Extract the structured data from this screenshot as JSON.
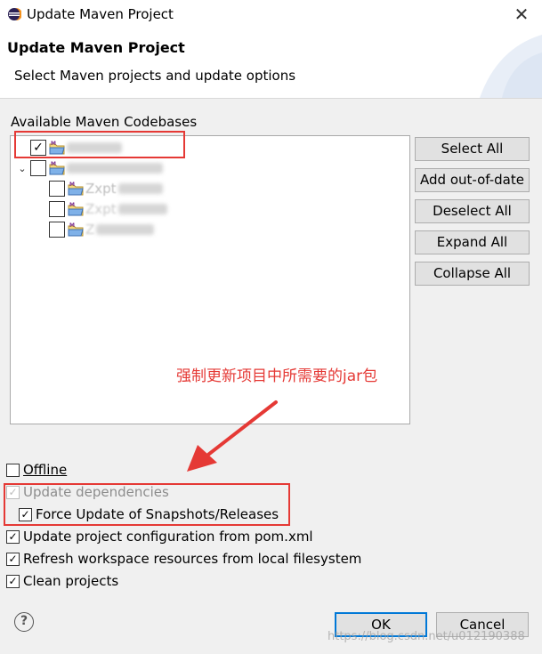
{
  "window": {
    "title": "Update Maven Project",
    "close_glyph": "✕"
  },
  "header": {
    "title": "Update Maven Project",
    "subtitle": "Select Maven projects and update options"
  },
  "codebases": {
    "label": "Available Maven Codebases",
    "items": [
      {
        "checked": true,
        "expander": "",
        "blurred_label": true,
        "icon": "maven-project-icon"
      },
      {
        "checked": false,
        "expander": "⌄",
        "blurred_label": true,
        "icon": "maven-project-icon"
      },
      {
        "checked": false,
        "expander": "",
        "label_prefix": "Zxpt",
        "blurred_label": true,
        "icon": "maven-project-icon"
      },
      {
        "checked": false,
        "expander": "",
        "label_prefix": "Zxpt",
        "blurred_label": true,
        "icon": "maven-project-icon"
      },
      {
        "checked": false,
        "expander": "",
        "label_prefix": "Z",
        "blurred_label": true,
        "icon": "maven-project-icon"
      }
    ]
  },
  "buttons": {
    "select_all": "Select All",
    "add_out_of_date": "Add out-of-date",
    "deselect_all": "Deselect All",
    "expand_all": "Expand All",
    "collapse_all": "Collapse All"
  },
  "annotation": {
    "text": "强制更新项目中所需要的jar包",
    "color": "#e53935"
  },
  "options": {
    "offline": {
      "label": "Offline",
      "checked": false
    },
    "update_dependencies": {
      "label": "Update dependencies",
      "checked": true,
      "disabled": true
    },
    "force_update": {
      "label": "Force Update of Snapshots/Releases",
      "checked": true
    },
    "update_config": {
      "label": "Update project configuration from pom.xml",
      "checked": true
    },
    "refresh_workspace": {
      "label": "Refresh workspace resources from local filesystem",
      "checked": true
    },
    "clean_projects": {
      "label": "Clean projects",
      "checked": true
    }
  },
  "footer": {
    "help_glyph": "?",
    "ok": "OK",
    "cancel": "Cancel",
    "watermark": "https://blog.csdn.net/u012190388"
  },
  "colors": {
    "accent": "#0078d7",
    "highlight_box": "#e53935"
  }
}
